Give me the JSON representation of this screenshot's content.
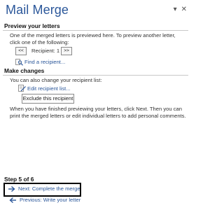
{
  "pane": {
    "title": "Mail Merge",
    "options_glyph": "▾",
    "close_glyph": "✕"
  },
  "preview": {
    "heading": "Preview your letters",
    "description": "One of the merged letters is previewed here. To preview another letter, click one of the following:",
    "prev_glyph": "<<",
    "next_glyph": ">>",
    "recipient_label": "Recipient: 1",
    "find_recipient": "Find a recipient..."
  },
  "changes": {
    "heading": "Make changes",
    "description": "You can also change your recipient list:",
    "edit_list": "Edit recipient list...",
    "exclude_button": "Exclude this recipient",
    "finish_text": "When you have finished previewing your letters, click Next. Then you can print the merged letters or edit individual letters to add personal comments."
  },
  "footer": {
    "step": "Step 5 of 6",
    "next_link": "Next: Complete the merge",
    "previous_link": "Previous: Write your letter"
  },
  "colors": {
    "accent": "#2b579a",
    "highlight_border": "#000000"
  }
}
